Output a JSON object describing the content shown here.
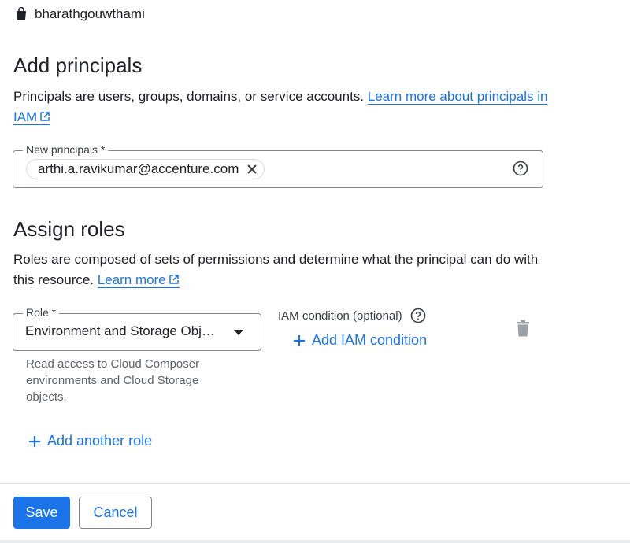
{
  "project": {
    "name": "bharathgouwthami",
    "icon": "project-bag-icon"
  },
  "principals": {
    "title": "Add principals",
    "description": "Principals are users, groups, domains, or service accounts.",
    "link_text": "Learn more about principals in IAM",
    "field_label": "New principals *",
    "chip_value": "arthi.a.ravikumar@accenture.com"
  },
  "roles": {
    "title": "Assign roles",
    "description": "Roles are composed of sets of permissions and determine what the principal can do with this resource.",
    "link_text": "Learn more",
    "role_label": "Role *",
    "role_value": "Environment and Storage Obj…",
    "role_hint": "Read access to Cloud Composer environments and Cloud Storage objects.",
    "condition_label": "IAM condition (optional)",
    "add_condition_label": "Add IAM condition",
    "add_role_label": "Add another role"
  },
  "actions": {
    "save_label": "Save",
    "cancel_label": "Cancel"
  },
  "colors": {
    "accent": "#1a73e8",
    "border": "#80868b",
    "text": "#202124",
    "muted": "#5f6368"
  }
}
